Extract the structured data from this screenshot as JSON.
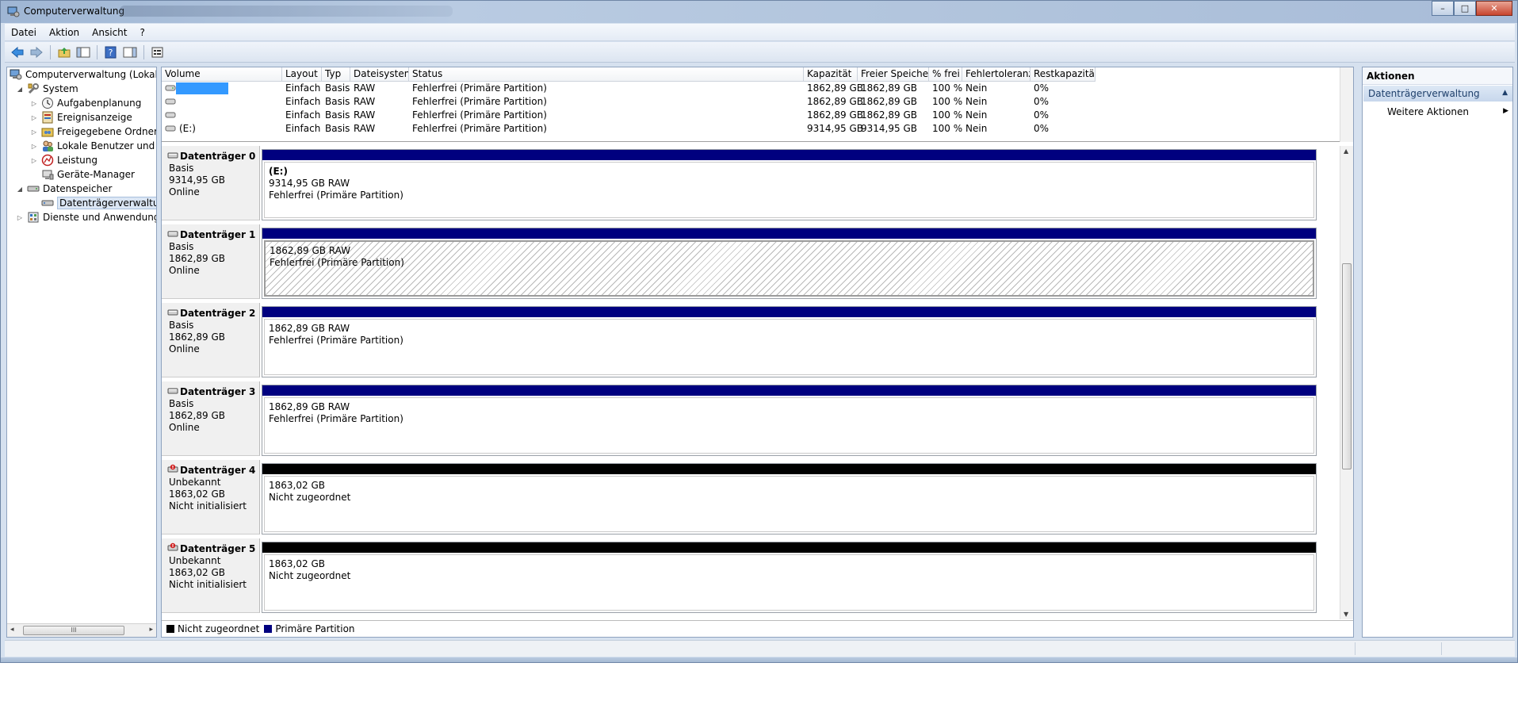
{
  "window": {
    "title": "Computerverwaltung",
    "controls": {
      "minimize": "–",
      "maximize": "□",
      "close": "✕"
    }
  },
  "menu": [
    "Datei",
    "Aktion",
    "Ansicht",
    "?"
  ],
  "toolbar": {
    "icons": [
      "back-arrow-icon",
      "forward-arrow-icon",
      "up-folder-icon",
      "show-hide-tree-icon",
      "help-icon",
      "show-hide-action-pane-icon",
      "properties-icon"
    ]
  },
  "tree": {
    "items": [
      {
        "label": "Computerverwaltung (Lokal)",
        "icon": "computer-management-icon",
        "level": 0,
        "expander": ""
      },
      {
        "label": "System",
        "icon": "system-tools-icon",
        "level": 1,
        "expander": "◢"
      },
      {
        "label": "Aufgabenplanung",
        "icon": "task-scheduler-icon",
        "level": 2,
        "expander": "▷"
      },
      {
        "label": "Ereignisanzeige",
        "icon": "event-viewer-icon",
        "level": 2,
        "expander": "▷"
      },
      {
        "label": "Freigegebene Ordner",
        "icon": "shared-folders-icon",
        "level": 2,
        "expander": "▷"
      },
      {
        "label": "Lokale Benutzer und Gr",
        "icon": "local-users-icon",
        "level": 2,
        "expander": "▷"
      },
      {
        "label": "Leistung",
        "icon": "performance-icon",
        "level": 2,
        "expander": "▷"
      },
      {
        "label": "Geräte-Manager",
        "icon": "device-manager-icon",
        "level": 2,
        "expander": ""
      },
      {
        "label": "Datenspeicher",
        "icon": "storage-icon",
        "level": 1,
        "expander": "◢"
      },
      {
        "label": "Datenträgerverwaltung",
        "icon": "disk-management-icon",
        "level": 2,
        "expander": "",
        "selected": true
      },
      {
        "label": "Dienste und Anwendungen",
        "icon": "services-applications-icon",
        "level": 1,
        "expander": "▷"
      }
    ],
    "scroll_grip": "III"
  },
  "volumes": {
    "columns": [
      "Volume",
      "Layout",
      "Typ",
      "Dateisystem",
      "Status",
      "Kapazität",
      "Freier Speicher",
      "% frei",
      "Fehlertoleranz",
      "Restkapazität"
    ],
    "rows": [
      {
        "volume": "",
        "layout": "Einfach",
        "typ": "Basis",
        "fs": "RAW",
        "status": "Fehlerfrei (Primäre Partition)",
        "kap": "1862,89 GB",
        "frei": "1862,89 GB",
        "pct": "100 %",
        "fehler": "Nein",
        "rest": "0%",
        "selected": true
      },
      {
        "volume": "",
        "layout": "Einfach",
        "typ": "Basis",
        "fs": "RAW",
        "status": "Fehlerfrei (Primäre Partition)",
        "kap": "1862,89 GB",
        "frei": "1862,89 GB",
        "pct": "100 %",
        "fehler": "Nein",
        "rest": "0%"
      },
      {
        "volume": "",
        "layout": "Einfach",
        "typ": "Basis",
        "fs": "RAW",
        "status": "Fehlerfrei (Primäre Partition)",
        "kap": "1862,89 GB",
        "frei": "1862,89 GB",
        "pct": "100 %",
        "fehler": "Nein",
        "rest": "0%"
      },
      {
        "volume": "(E:)",
        "layout": "Einfach",
        "typ": "Basis",
        "fs": "RAW",
        "status": "Fehlerfrei (Primäre Partition)",
        "kap": "9314,95 GB",
        "frei": "9314,95 GB",
        "pct": "100 %",
        "fehler": "Nein",
        "rest": "0%"
      }
    ]
  },
  "disks": [
    {
      "name": "Datenträger 0",
      "type": "Basis",
      "size": "9314,95 GB",
      "state": "Online",
      "bar_color": "#00007f",
      "part_name": "(E:)",
      "part_line1": "9314,95 GB RAW",
      "part_line2": "Fehlerfrei (Primäre Partition)",
      "hatched": false
    },
    {
      "name": "Datenträger 1",
      "type": "Basis",
      "size": "1862,89 GB",
      "state": "Online",
      "bar_color": "#00007f",
      "part_name": "",
      "part_line1": "1862,89 GB RAW",
      "part_line2": "Fehlerfrei (Primäre Partition)",
      "hatched": true
    },
    {
      "name": "Datenträger 2",
      "type": "Basis",
      "size": "1862,89 GB",
      "state": "Online",
      "bar_color": "#00007f",
      "part_name": "",
      "part_line1": "1862,89 GB RAW",
      "part_line2": "Fehlerfrei (Primäre Partition)",
      "hatched": false
    },
    {
      "name": "Datenträger 3",
      "type": "Basis",
      "size": "1862,89 GB",
      "state": "Online",
      "bar_color": "#00007f",
      "part_name": "",
      "part_line1": "1862,89 GB RAW",
      "part_line2": "Fehlerfrei (Primäre Partition)",
      "hatched": false
    },
    {
      "name": "Datenträger 4",
      "type": "Unbekannt",
      "size": "1863,02 GB",
      "state": "Nicht initialisiert",
      "bar_color": "#000000",
      "part_name": "",
      "part_line1": "1863,02 GB",
      "part_line2": "Nicht zugeordnet",
      "hatched": false
    },
    {
      "name": "Datenträger 5",
      "type": "Unbekannt",
      "size": "1863,02 GB",
      "state": "Nicht initialisiert",
      "bar_color": "#000000",
      "part_name": "",
      "part_line1": "1863,02 GB",
      "part_line2": "Nicht zugeordnet",
      "hatched": false
    }
  ],
  "legend": [
    {
      "label": "Nicht zugeordnet",
      "color": "#000000"
    },
    {
      "label": "Primäre Partition",
      "color": "#00007f"
    }
  ],
  "actions": {
    "title": "Aktionen",
    "section": "Datenträgerverwaltung",
    "more": "Weitere Aktionen"
  },
  "colors": {
    "primary_partition": "#00007f",
    "unallocated": "#000000",
    "selection": "#3399ff"
  }
}
